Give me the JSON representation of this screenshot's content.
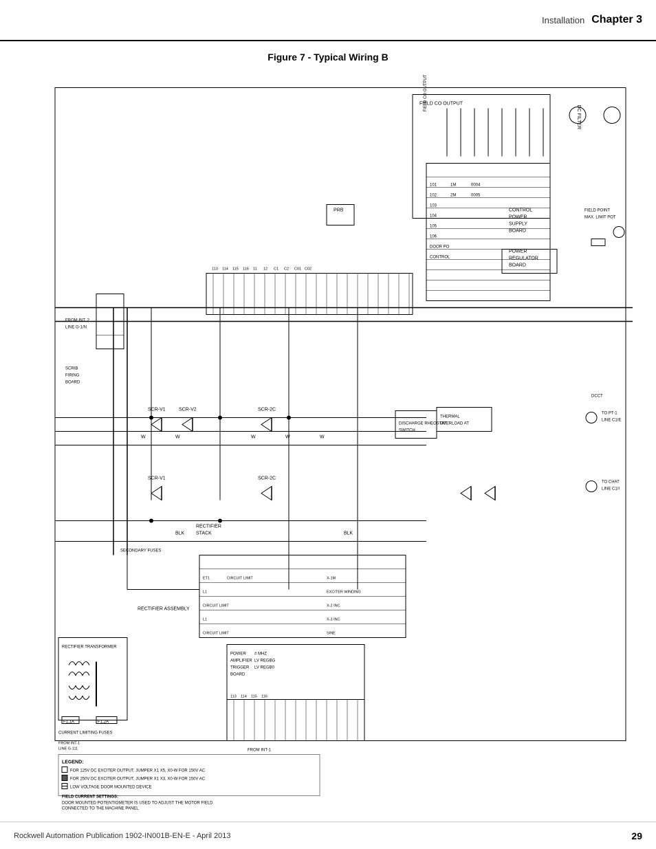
{
  "header": {
    "installation_label": "Installation",
    "chapter_label": "Chapter 3"
  },
  "footer": {
    "publication": "Rockwell Automation Publication 1902-IN001B-EN-E - April 2013",
    "page_number": "29"
  },
  "figure": {
    "title": "Figure 7 - Typical Wiring B"
  },
  "legend": {
    "title": "LEGEND:",
    "items": [
      "FOR 125V DC EXCITER OUTPUT, JUMPER X1 XS, XO-W FOR 150V AC",
      "FOR 250V DC EXCITER OUTPUT, JUMPER X1 X3, XO-W FOR 150V AC",
      "LOW VOLTAGE DOOR MOUNTED DEVICE",
      "FIELD CURRENT SETTINGS:",
      "DOOR MOUNTED POTENTIOMETER IS USED TO ADJUST THE MOTOR FIELD",
      "CONNECTED TO THE MACHINE PANEL"
    ]
  }
}
